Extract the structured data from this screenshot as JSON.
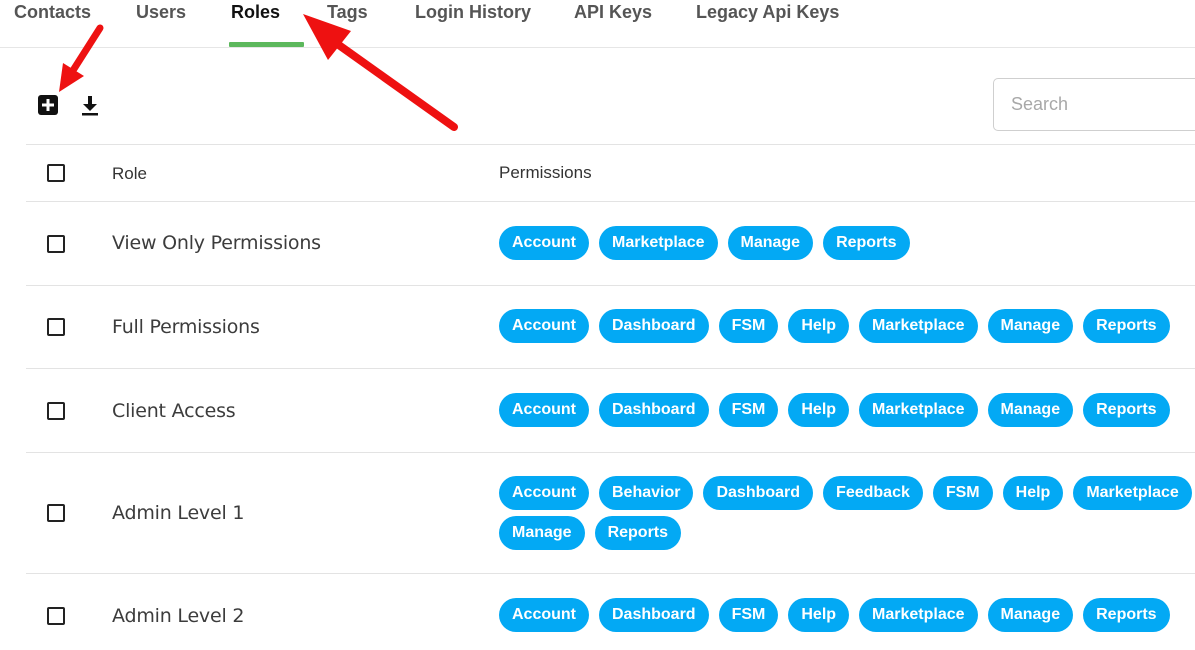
{
  "tabs": [
    {
      "label": "Contacts"
    },
    {
      "label": "Users"
    },
    {
      "label": "Roles"
    },
    {
      "label": "Tags"
    },
    {
      "label": "Login History"
    },
    {
      "label": "API Keys"
    },
    {
      "label": "Legacy Api Keys"
    }
  ],
  "active_tab": "Roles",
  "toolbar": {
    "add_icon": "plus-square-icon",
    "download_icon": "download-icon",
    "search_placeholder": "Search",
    "search_value": ""
  },
  "table": {
    "headers": {
      "role": "Role",
      "permissions": "Permissions"
    },
    "rows": [
      {
        "role": "View Only Permissions",
        "permissions": [
          "Account",
          "Marketplace",
          "Manage",
          "Reports"
        ]
      },
      {
        "role": "Full Permissions",
        "permissions": [
          "Account",
          "Dashboard",
          "FSM",
          "Help",
          "Marketplace",
          "Manage",
          "Reports"
        ]
      },
      {
        "role": "Client Access",
        "permissions": [
          "Account",
          "Dashboard",
          "FSM",
          "Help",
          "Marketplace",
          "Manage",
          "Reports"
        ]
      },
      {
        "role": "Admin Level 1",
        "permissions": [
          "Account",
          "Behavior",
          "Dashboard",
          "Feedback",
          "FSM",
          "Help",
          "Marketplace",
          "Manage",
          "Reports"
        ]
      },
      {
        "role": "Admin Level 2",
        "permissions": [
          "Account",
          "Dashboard",
          "FSM",
          "Help",
          "Marketplace",
          "Manage",
          "Reports"
        ]
      }
    ]
  },
  "colors": {
    "chip": "#03a9f4",
    "tab_underline": "#5cb85c",
    "annotation_arrow": "#ee1111"
  }
}
